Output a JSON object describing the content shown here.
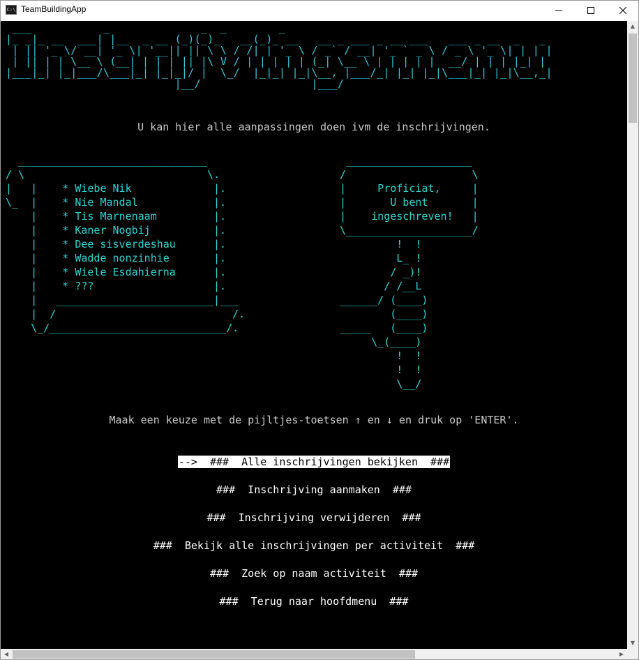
{
  "window": {
    "title": "TeamBuildingApp",
    "icon": "console-app-icon",
    "icon_text": "C:\\"
  },
  "banner": {
    "ascii": " ___           _              _  _        _                                         \n|_ _|_ __  ___| |__  _ __ (_)(_)_   __(_)_ __   __ _ ___ _ __ ___   ___ _ __  _   _ \n | || '_ \\/ __| '_ \\| '__|| || \\ \\ / /| | '_ \\ / _` / __| '_ ` _ \\ / _ \\ '_ \\| | | |\n | || | | \\__ \\ (__| | | | || |\\ V / | | | | | (_| \\__ \\ | | | | |  __/ | | | |_| |\n|___|_| |_|___/\\___|_| |_|_|/ |  \\_/  |_|_| |_|\\__, |___/_| |_| |_|\\___|_| |_|\\__,_|\n                          |__/                 |___/                              "
  },
  "subtitle": "U kan hier alle aanpassingen doen ivm de inschrijvingen.",
  "scroll_art": {
    "lines": [
      "  ______________________________",
      "/ \\                             \\.",
      "|   |    * Wiebe Nik             |.",
      "\\_  |    * Nie Mandal            |.",
      "    |    * Tis Marnenaam         |.",
      "    |    * Kaner Nogbij          |.",
      "    |    * Dee sisverdeshau      |.",
      "    |    * Wadde nonzinhie       |.",
      "    |    * Wiele Esdahierna      |.",
      "    |    * ???                   |.",
      "    |   _________________________|___",
      "    |  /                            /.",
      "    \\_/____________________________/."
    ]
  },
  "sign_art": {
    "lines": [
      " ____________________",
      "/                    \\",
      "|     Proficiat,     |",
      "|       U bent       |",
      "|    ingeschreven!   |",
      "\\____________________/",
      "         !  !",
      "         L_ !",
      "        / _)!",
      "       / /__L",
      "______/ (____)",
      "        (____)",
      "_____   (____)",
      "     \\_(____)",
      "         !  !",
      "         !  !",
      "         \\__/"
    ]
  },
  "instruction": "Maak een keuze met de pijltjes-toetsen ↑ en ↓ en druk op 'ENTER'.",
  "menu": {
    "items": [
      {
        "label": "-->  ###  Alle inschrijvingen bekijken  ###",
        "selected": true
      },
      {
        "label": "###  Inschrijving aanmaken  ###",
        "selected": false
      },
      {
        "label": "###  Inschrijving verwijderen  ###",
        "selected": false
      },
      {
        "label": "###  Bekijk alle inschrijvingen per activiteit  ###",
        "selected": false
      },
      {
        "label": "###  Zoek op naam activiteit  ###",
        "selected": false
      },
      {
        "label": "###  Terug naar hoofdmenu  ###",
        "selected": false
      }
    ]
  },
  "colors": {
    "background": "#000000",
    "ascii_cyan": "#28d6d2",
    "text_gray": "#c8c8c8",
    "menu_white": "#ffffff",
    "selection_bg": "#ffffff",
    "selection_fg": "#000000"
  },
  "scrollbars": {
    "vertical_icon_up": "chevron-up-icon",
    "vertical_icon_down": "chevron-down-icon",
    "horizontal_icon_left": "chevron-left-icon",
    "horizontal_icon_right": "chevron-right-icon"
  }
}
